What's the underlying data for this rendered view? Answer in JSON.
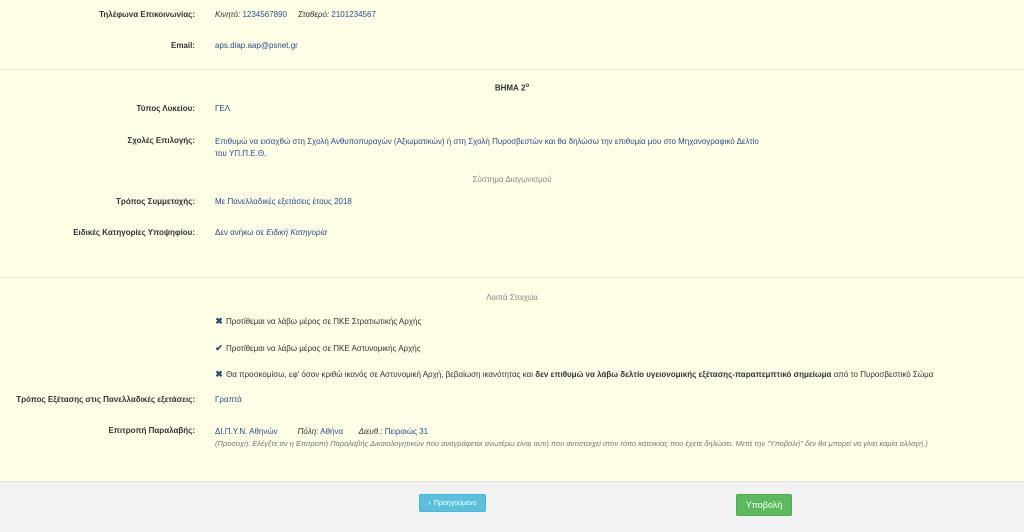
{
  "contact": {
    "phones_label": "Τηλέφωνα Επικοινωνίας:",
    "mobile_label": "Κινητό:",
    "mobile_value": "1234567890",
    "landline_label": "Σταθερό:",
    "landline_value": "2101234567",
    "email_label": "Email:",
    "email_value": "aps.diap.aap@psnet.gr"
  },
  "step2": {
    "title": "ΒΗΜΑ 2",
    "title_sup": "ο",
    "school_type_label": "Τύπος Λυκείου:",
    "school_type_value": "ΓΕΛ",
    "schools_label": "Σχολές Επιλογής:",
    "schools_value_line1": "Επιθυμώ να εισαχθώ στη Σχολή Ανθυποπυραγών (Αξιωματικών) ή στη Σχολή Πυροσβεστών και θα δηλώσω την επιθυμία μου στο Μηχανογραφικό Δελτίο",
    "schools_value_line2": "του ΥΠ.Π.Ε.Θ.",
    "system_title": "Σύστημα Διαγωνισμού",
    "participation_label": "Τρόπος Συμμετοχής:",
    "participation_value": "Με Πανελλαδικές εξετάσεις έτους 2018",
    "special_label": "Ειδικές Κατηγορίες Υποψηφίου:",
    "special_value_prefix": "Δεν ανήκω σε ",
    "special_value_italic": "Ειδική Κατηγορία"
  },
  "other": {
    "title": "Λοιπά Στοιχεία",
    "item1_icon": "cross-icon",
    "item1_text": "Προτίθεμαι να λάβω μέρος σε ΠΚΕ Στρατιωτικής Αρχής",
    "item2_icon": "check-icon",
    "item2_text": "Προτίθεμαι να λάβω μέρος σε ΠΚΕ Αστυνομικής Αρχής",
    "item3_icon": "cross-icon",
    "item3_text_a": "Θα προσκομίσω, εφ' όσον κριθώ ικανός σε Αστυνομική Αρχή, βεβαίωση ικανότητας και ",
    "item3_text_b": "δεν επιθυμώ να λάβω δελτίο υγειονομικής εξέτασης-παραπεμπτικό σημείωμα",
    "item3_text_c": " από το Πυροσβεστικό Σώμα",
    "exam_mode_label": "Τρόπος Εξέτασης στις Πανελλαδικές εξετάσεις:",
    "exam_mode_value": "Γραπτά",
    "committee_label": "Επιτροπή Παραλαβής:",
    "committee_name": "ΔΙ.Π.Υ.Ν. Αθηνών",
    "city_label": "Πόλη:",
    "city_value": "Αθήνα",
    "address_label": "Διευθ.:",
    "address_value": "Πειραιώς 31",
    "note": "(Προσοχή: Ελέγξτε αν η Επιτροπή Παραλαβής Δικαιολογητικών που αναγράφεται ανωτέρω είναι αυτή που αντιστοιχεί στον τόπο κατοικίας που έχετε δηλώσει. Μετά την \"Υποβολή\" δεν θα μπορεί να γίνει καμία αλλαγή.)"
  },
  "footer": {
    "prev_label": "Προηγούμενο",
    "submit_label": "Υποβολή"
  }
}
